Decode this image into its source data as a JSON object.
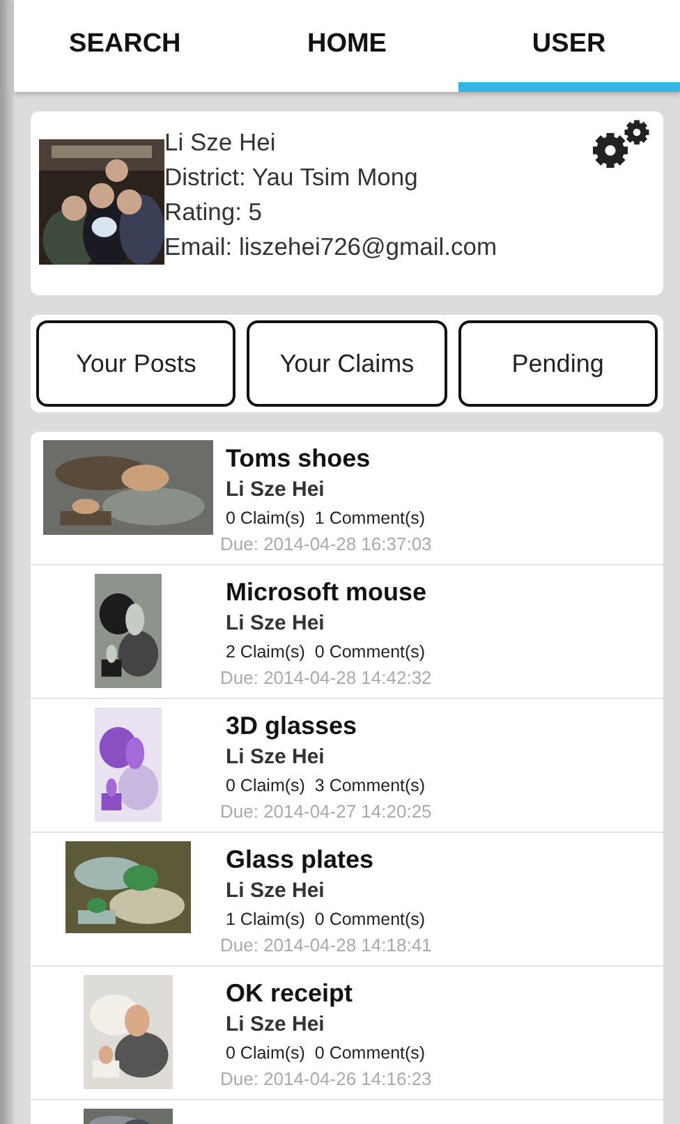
{
  "tabs": [
    {
      "label": "SEARCH",
      "selected": false
    },
    {
      "label": "HOME",
      "selected": false
    },
    {
      "label": "USER",
      "selected": true
    }
  ],
  "profile": {
    "name": "Li Sze Hei",
    "district": "District: Yau Tsim Mong",
    "rating": "Rating: 5",
    "email": "Email: liszehei726@gmail.com"
  },
  "buttons": [
    "Your Posts",
    "Your Claims",
    "Pending"
  ],
  "posts": [
    {
      "title": "Toms shoes",
      "owner": "Li Sze Hei",
      "counts": "0 Claim(s)  1 Comment(s)",
      "due": "Due: 2014-04-28 16:37:03"
    },
    {
      "title": "Microsoft mouse",
      "owner": "Li Sze Hei",
      "counts": "2 Claim(s)  0 Comment(s)",
      "due": "Due: 2014-04-28 14:42:32"
    },
    {
      "title": "3D glasses",
      "owner": "Li Sze Hei",
      "counts": "0 Claim(s)  3 Comment(s)",
      "due": "Due: 2014-04-27 14:20:25"
    },
    {
      "title": "Glass plates",
      "owner": "Li Sze Hei",
      "counts": "1 Claim(s)  0 Comment(s)",
      "due": "Due: 2014-04-28 14:18:41"
    },
    {
      "title": "OK receipt",
      "owner": "Li Sze Hei",
      "counts": "0 Claim(s)  0 Comment(s)",
      "due": "Due: 2014-04-26 14:16:23"
    },
    {
      "kind": "picture"
    }
  ]
}
